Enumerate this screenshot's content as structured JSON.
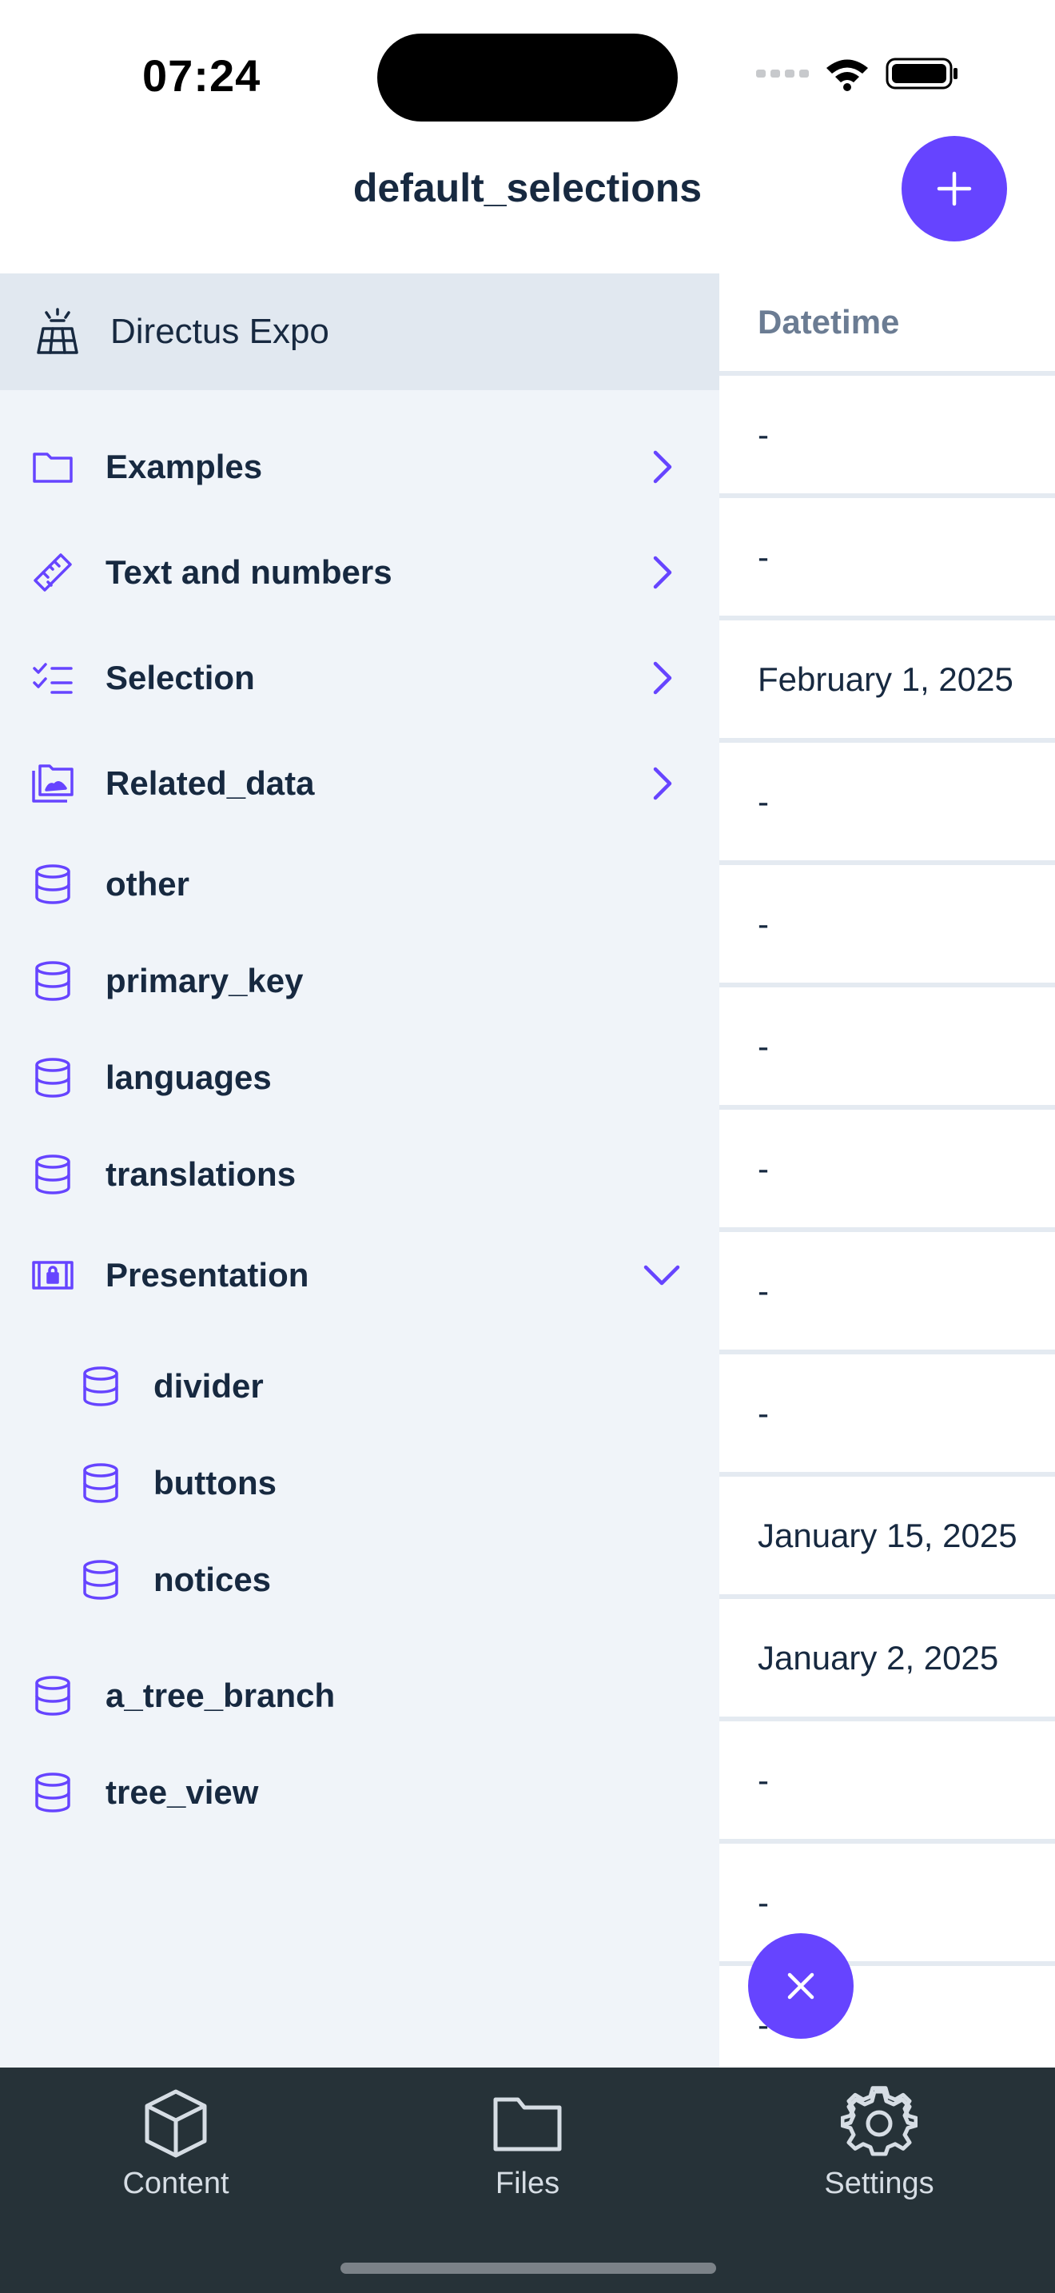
{
  "status_bar": {
    "time": "07:24"
  },
  "header": {
    "title": "default_selections"
  },
  "project": {
    "name": "Directus Expo"
  },
  "nav": {
    "items": [
      {
        "label": "Examples",
        "icon": "folder-icon"
      },
      {
        "label": "Text and numbers",
        "icon": "ruler-icon"
      },
      {
        "label": "Selection",
        "icon": "checklist-icon"
      },
      {
        "label": "Related_data",
        "icon": "photo-folder-icon"
      },
      {
        "label": "other",
        "icon": "database-icon"
      },
      {
        "label": "primary_key",
        "icon": "database-icon"
      },
      {
        "label": "languages",
        "icon": "database-icon"
      },
      {
        "label": "translations",
        "icon": "database-icon"
      },
      {
        "label": "Presentation",
        "icon": "locked-panel-icon"
      },
      {
        "label": "divider",
        "icon": "database-icon"
      },
      {
        "label": "buttons",
        "icon": "database-icon"
      },
      {
        "label": "notices",
        "icon": "database-icon"
      },
      {
        "label": "a_tree_branch",
        "icon": "database-icon"
      },
      {
        "label": "tree_view",
        "icon": "database-icon"
      }
    ]
  },
  "table": {
    "column_header": "Datetime",
    "rows": [
      "-",
      "-",
      "February 1, 2025",
      "-",
      "-",
      "-",
      "-",
      "-",
      "-",
      "January 15, 2025",
      "January 2, 2025",
      "-",
      "-",
      "-"
    ]
  },
  "tabbar": {
    "tabs": [
      {
        "label": "Content",
        "icon": "cube-icon"
      },
      {
        "label": "Files",
        "icon": "folder-icon"
      },
      {
        "label": "Settings",
        "icon": "gear-icon"
      }
    ]
  },
  "colors": {
    "accent": "#6644ff",
    "sidebar_bg": "#f0f4f9",
    "tabbar_bg": "#263238"
  }
}
